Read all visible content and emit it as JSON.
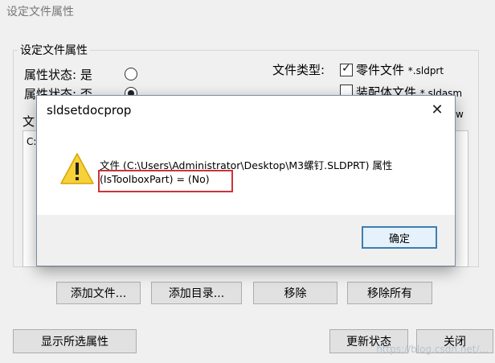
{
  "window": {
    "title": "设定文件属性"
  },
  "group": {
    "label": "设定文件属性",
    "radio_yes_label": "属性状态: 是",
    "radio_no_label": "属性状态: 否",
    "file_type_label": "文件类型:",
    "types": [
      {
        "label": "零件文件",
        "ext": "*.sldprt",
        "checked": true
      },
      {
        "label": "装配体文件",
        "ext": "*.sldasm",
        "checked": false
      }
    ],
    "file_list_label_partial": "文",
    "file_list_first_item_partial": "C:",
    "side_fragment": "w"
  },
  "buttons": {
    "add_file": "添加文件...",
    "add_dir": "添加目录...",
    "remove": "移除",
    "remove_all": "移除所有",
    "show_props": "显示所选属性",
    "update_state": "更新状态",
    "close": "关闭"
  },
  "dialog": {
    "title": "sldsetdocprop",
    "message_line1": "文件 (C:\\Users\\Administrator\\Desktop\\M3螺钉.SLDPRT) 属性",
    "message_line2": "(IsToolboxPart) = (No)",
    "ok_label": "确定",
    "close_glyph": "✕"
  },
  "watermark": "https://blog.csdn.net/..."
}
